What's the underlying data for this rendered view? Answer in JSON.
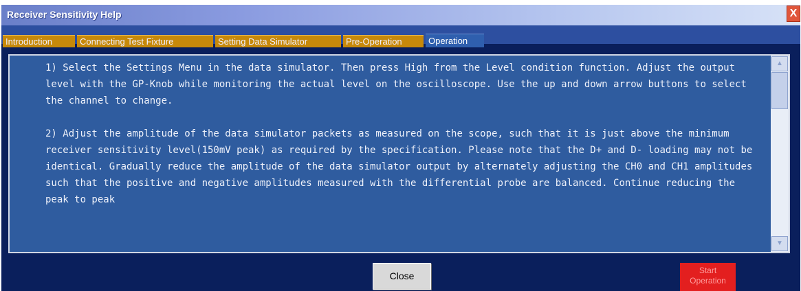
{
  "window": {
    "title": "Receiver Sensitivity Help",
    "close_glyph": "X"
  },
  "tabs": [
    {
      "label": "Introduction",
      "active": false
    },
    {
      "label": "Connecting Test Fixture",
      "active": false
    },
    {
      "label": "Setting Data Simulator",
      "active": false
    },
    {
      "label": "Pre-Operation",
      "active": false
    },
    {
      "label": "Operation",
      "active": true
    }
  ],
  "content": {
    "paragraph1": "1) Select the Settings Menu in the data simulator. Then press High from the Level condition function. Adjust the output level with the GP-Knob while monitoring the actual level on the oscilloscope. Use the up and down arrow buttons to select the channel to change.",
    "paragraph2": "2) Adjust the amplitude of the data simulator packets as measured on the scope, such that it is just above the minimum receiver sensitivity level(150mV peak) as required by the specification. Please note that the D+ and D- loading may not be identical. Gradually reduce the amplitude of the data simulator output by alternately adjusting the CH0 and CH1 amplitudes such that the positive and negative amplitudes measured with the differential probe are balanced. Continue reducing the peak to peak"
  },
  "scrollbar": {
    "up_glyph": "▲",
    "down_glyph": "▼"
  },
  "buttons": {
    "close_label": "Close",
    "start_label_line1": "Start",
    "start_label_line2": "Operation"
  },
  "colors": {
    "window_bg": "#0a1f5c",
    "tab_inactive": "#c7890a",
    "pane_bg": "#2f5c9f",
    "start_button": "#e31f1f"
  }
}
